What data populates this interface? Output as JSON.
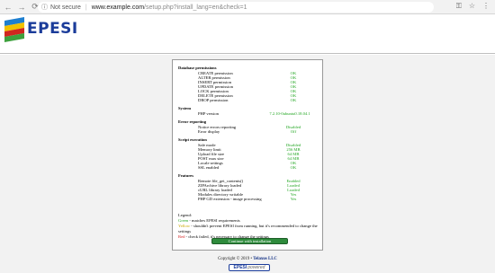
{
  "browser": {
    "back": "←",
    "forward": "→",
    "reload": "⟳",
    "info": "ⓘ",
    "security": "Not secure",
    "host": "www.example.com",
    "path": "/setup.php?install_lang=en&check=1",
    "key_icon": "⚿",
    "star_icon": "☆",
    "menu_icon": "⋮"
  },
  "logo": {
    "text": "EPESI"
  },
  "sections": {
    "db": {
      "title": "Database permissions",
      "rows": [
        {
          "label": "CREATE permission",
          "value": "OK"
        },
        {
          "label": "ALTER permission",
          "value": "OK"
        },
        {
          "label": "INSERT permission",
          "value": "OK"
        },
        {
          "label": "UPDATE permission",
          "value": "OK"
        },
        {
          "label": "LOCK permission",
          "value": "OK"
        },
        {
          "label": "DELETE permission",
          "value": "OK"
        },
        {
          "label": "DROP permission",
          "value": "OK"
        }
      ]
    },
    "system": {
      "title": "System",
      "rows": [
        {
          "label": "PHP version",
          "value": "7.2.10-0ubuntu0.18.04.1"
        }
      ]
    },
    "errors": {
      "title": "Error reporting",
      "rows": [
        {
          "label": "Notice errors reporting",
          "value": "Disabled"
        },
        {
          "label": "Error display",
          "value": "Off"
        }
      ]
    },
    "script": {
      "title": "Script execution",
      "rows": [
        {
          "label": "Safe mode",
          "value": "Disabled"
        },
        {
          "label": "Memory limit",
          "value": "256 MB"
        },
        {
          "label": "Upload file size",
          "value": "64 MB"
        },
        {
          "label": "POST max size",
          "value": "64 MB"
        },
        {
          "label": "Locale settings",
          "value": "OK"
        },
        {
          "label": "SSL enabled",
          "value": "OK"
        }
      ]
    },
    "features": {
      "title": "Features",
      "rows": [
        {
          "label": "Remote file_get_contents()",
          "value": "Enabled"
        },
        {
          "label": "ZIPArchive library loaded",
          "value": "Loaded"
        },
        {
          "label": "cURL library loaded",
          "value": "Loaded"
        },
        {
          "label": "Modules directory writable",
          "value": "Yes"
        },
        {
          "label": "PHP GD extension - image processing",
          "value": "Yes"
        }
      ]
    }
  },
  "legend": {
    "title": "Legend:",
    "green_word": "Green",
    "green_text": " - matches EPESI requirements",
    "yellow_word": "Yellow",
    "yellow_text": " - shouldn't prevent EPESI from running, but it's recommended to change the settings",
    "red_word": "Red",
    "red_text": " - check failed, it's necessary to change the settings"
  },
  "continue_label": "Continue with installation",
  "footer": {
    "copyright": "Copyright © 2019 • ",
    "company": "Telaxus LLC",
    "powered_brand": "EPESI",
    "powered_suffix": "powered"
  },
  "colors": {
    "ok": "#22a622",
    "warn": "#c8a800",
    "fail": "#d42020",
    "brand": "#1b3c9a",
    "button": "#2e8b3c"
  }
}
